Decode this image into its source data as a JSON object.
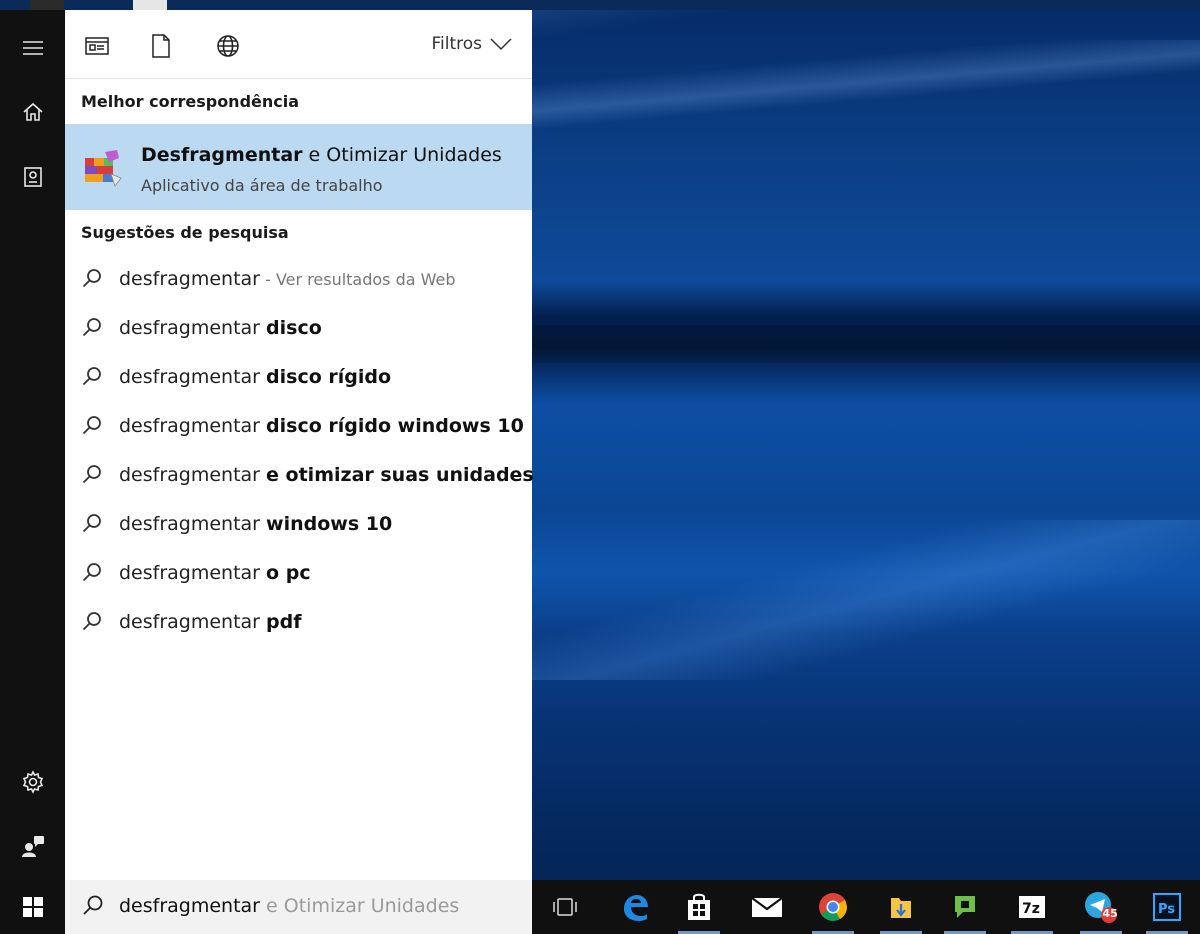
{
  "filters": {
    "label": "Filtros",
    "icons": [
      "apps-filter-icon",
      "documents-filter-icon",
      "web-filter-icon"
    ]
  },
  "best_match": {
    "header": "Melhor correspondência",
    "title_bold": "Desfragmentar",
    "title_rest": " e Otimizar Unidades",
    "subtitle": "Aplicativo da área de trabalho"
  },
  "suggestions": {
    "header": "Sugestões de pesquisa",
    "items": [
      {
        "prefix": "desfragmentar",
        "bold": "",
        "web": " - Ver resultados da Web"
      },
      {
        "prefix": "desfragmentar ",
        "bold": "disco",
        "web": ""
      },
      {
        "prefix": "desfragmentar ",
        "bold": "disco rígido",
        "web": ""
      },
      {
        "prefix": "desfragmentar ",
        "bold": "disco rígido windows 10",
        "web": ""
      },
      {
        "prefix": "desfragmentar ",
        "bold": "e otimizar suas unidades",
        "web": ""
      },
      {
        "prefix": "desfragmentar ",
        "bold": "windows 10",
        "web": ""
      },
      {
        "prefix": "desfragmentar ",
        "bold": "o pc",
        "web": ""
      },
      {
        "prefix": "desfragmentar ",
        "bold": "pdf",
        "web": ""
      }
    ]
  },
  "search": {
    "typed": "desfragmentar",
    "completion": " e Otimizar Unidades"
  },
  "taskbar": {
    "apps": [
      "task-view-icon",
      "edge-icon",
      "store-icon",
      "mail-icon",
      "chrome-icon",
      "file-explorer-icon",
      "picpick-icon",
      "7zip-icon",
      "telegram-icon",
      "photoshop-icon"
    ],
    "telegram_badge": "45"
  }
}
